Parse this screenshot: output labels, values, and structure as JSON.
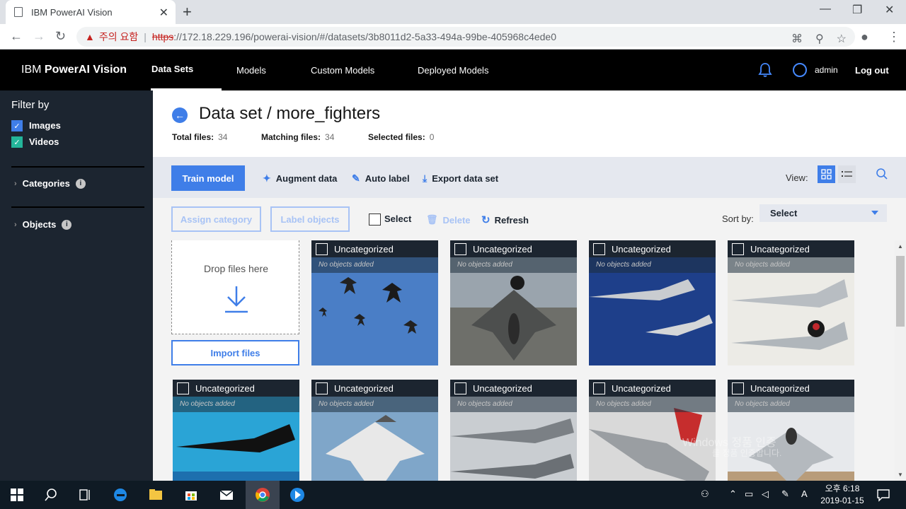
{
  "browser": {
    "tab_title": "IBM PowerAI Vision",
    "url_warning": "주의 요함",
    "url_scheme": "https",
    "url_rest": "://172.18.229.196/powerai-vision/#/datasets/3b8011d2-5a33-494a-99be-405968c4ede0"
  },
  "header": {
    "brand_prefix": "IBM ",
    "brand_name": "PowerAI Vision",
    "nav": [
      "Data Sets",
      "Models",
      "Custom Models",
      "Deployed Models"
    ],
    "user": "admin",
    "logout": "Log out"
  },
  "sidebar": {
    "title": "Filter by",
    "filters": [
      "Images",
      "Videos"
    ],
    "sections": [
      "Categories",
      "Objects"
    ]
  },
  "dataset": {
    "title": "Data set / more_fighters",
    "total_label": "Total files:",
    "total_value": "34",
    "matching_label": "Matching files:",
    "matching_value": "34",
    "selected_label": "Selected files:",
    "selected_value": "0"
  },
  "toolbar": {
    "train": "Train model",
    "augment": "Augment data",
    "autolabel": "Auto label",
    "export": "Export data set",
    "view_label": "View:",
    "assign": "Assign category",
    "label_objects": "Label objects",
    "select": "Select",
    "delete": "Delete",
    "refresh": "Refresh",
    "sort_label": "Sort by:",
    "sort_value": "Select"
  },
  "upload": {
    "drop_text": "Drop files here",
    "import": "Import files"
  },
  "tiles": [
    {
      "category": "Uncategorized",
      "objects": "No objects added"
    },
    {
      "category": "Uncategorized",
      "objects": "No objects added"
    },
    {
      "category": "Uncategorized",
      "objects": "No objects added"
    },
    {
      "category": "Uncategorized",
      "objects": "No objects added"
    },
    {
      "category": "Uncategorized",
      "objects": "No objects added"
    },
    {
      "category": "Uncategorized",
      "objects": "No objects added"
    },
    {
      "category": "Uncategorized",
      "objects": "No objects added"
    },
    {
      "category": "Uncategorized",
      "objects": "No objects added"
    },
    {
      "category": "Uncategorized",
      "objects": "No objects added"
    }
  ],
  "watermark": {
    "line1": "Windows 정품 인증",
    "line2": "를 정품 인증합니다."
  },
  "taskbar": {
    "time": "오후 6:18",
    "date": "2019-01-15"
  },
  "colors": {
    "accent": "#3f7ee8",
    "sidebar": "#1c2530",
    "header": "#000000"
  }
}
